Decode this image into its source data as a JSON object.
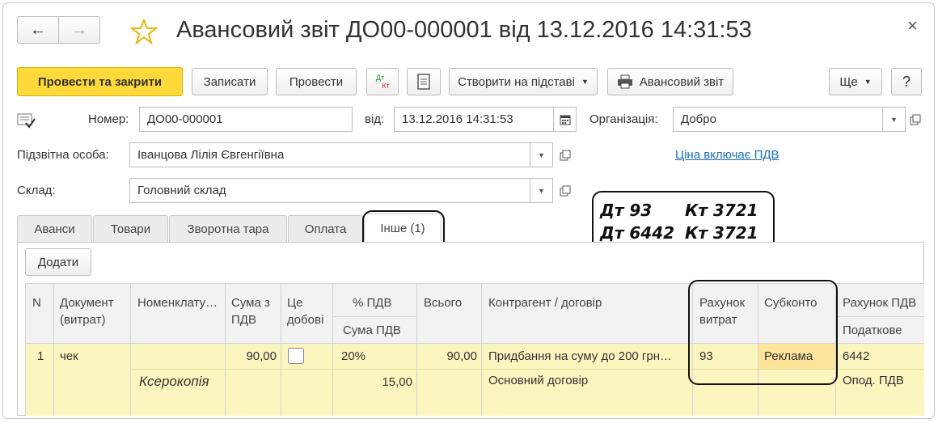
{
  "window": {
    "title": "Авансовий звіт ДО00-000001 від 13.12.2016 14:31:53"
  },
  "nav": {
    "back_icon": "←",
    "forward_icon": "→",
    "close_icon": "×"
  },
  "toolbar": {
    "post_close": "Провести та закрити",
    "save": "Записати",
    "post": "Провести",
    "dt_kt_top": "Дт",
    "dt_kt_bottom": "Кт",
    "create_based": "Створити на підставі",
    "print_report": "Авансовий звіт",
    "more": "Ще",
    "help": "?"
  },
  "form": {
    "number_label": "Номер:",
    "number_value": "ДО00-000001",
    "date_label": "від:",
    "date_value": "13.12.2016 14:31:53",
    "org_label": "Організація:",
    "org_value": "Добро",
    "person_label": "Підзвітна особа:",
    "person_value": "Іванцова Лілія Євгенгіївна",
    "vat_link": "Ціна включає ПДВ",
    "warehouse_label": "Склад:",
    "warehouse_value": "Головний склад"
  },
  "tabs": [
    {
      "label": "Аванси"
    },
    {
      "label": "Товари"
    },
    {
      "label": "Зворотна тара"
    },
    {
      "label": "Оплата"
    },
    {
      "label": "Інше (1)"
    }
  ],
  "annotation": {
    "line1_dt": "Дт 93",
    "line1_kt": "Кт 3721",
    "line2_dt": "Дт 6442",
    "line2_kt": "Кт 3721"
  },
  "table": {
    "add_button": "Додати",
    "headers": {
      "n": "N",
      "doc": "Документ (витрат)",
      "nomenclature": "Номенклату…",
      "sum_vat": "Сума з ПДВ",
      "daily": "Це добові",
      "vat_pct": "% ПДВ",
      "vat_sum": "Сума ПДВ",
      "total": "Всього",
      "counterparty": "Контрагент / договір",
      "expense_acc": "Рахунок витрат",
      "subconto": "Субконто",
      "vat_acc": "Рахунок ПДВ",
      "tax": "Податкове"
    },
    "row": {
      "n": "1",
      "doc": "чек",
      "nomenclature": "Ксерокопія",
      "sum_vat": "90,00",
      "vat_pct": "20%",
      "vat_sum": "15,00",
      "total": "90,00",
      "counterparty": "Придбання на суму до 200 грн…",
      "contract": "Основний договір",
      "expense_acc": "93",
      "subconto": "Реклама",
      "vat_acc": "6442",
      "tax": "Опод. ПДВ"
    }
  },
  "colors": {
    "accent_yellow": "#ffd93a",
    "row_highlight": "#fbf6bf",
    "link": "#1a6fb5"
  }
}
